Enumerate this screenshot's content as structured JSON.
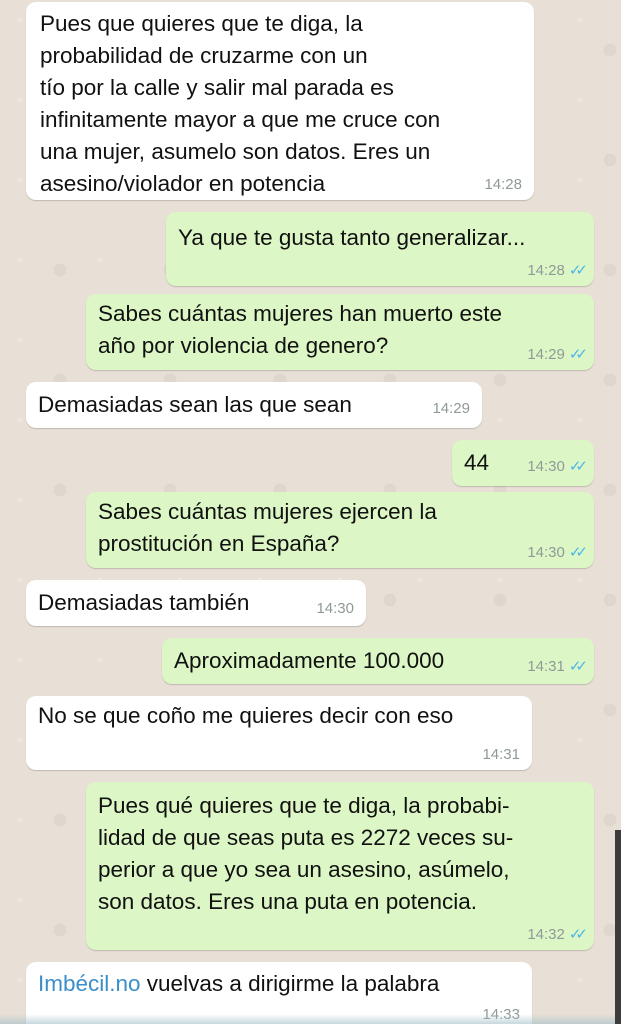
{
  "messages": [
    {
      "dir": "in",
      "lines": [
        "Pues que quieres que te diga, la",
        "probabilidad de cruzarme con un",
        "tío por la calle y salir mal parada es",
        "infinitamente mayor a que me cruce con",
        "una mujer, asumelo son datos. Eres un",
        "asesino/violador en potencia"
      ],
      "time": "14:28"
    },
    {
      "dir": "out",
      "lines": [
        "Ya que te gusta tanto generalizar..."
      ],
      "time": "14:28",
      "ticks": "✓✓"
    },
    {
      "dir": "out",
      "lines": [
        "Sabes cuántas mujeres han muerto este",
        "año por violencia de genero?"
      ],
      "time": "14:29",
      "ticks": "✓✓"
    },
    {
      "dir": "in",
      "lines": [
        "Demasiadas sean las que sean"
      ],
      "time": "14:29"
    },
    {
      "dir": "out",
      "lines": [
        "44"
      ],
      "time": "14:30",
      "ticks": "✓✓"
    },
    {
      "dir": "out",
      "lines": [
        "Sabes cuántas mujeres ejercen la",
        "prostitución en España?"
      ],
      "time": "14:30",
      "ticks": "✓✓"
    },
    {
      "dir": "in",
      "lines": [
        "Demasiadas también"
      ],
      "time": "14:30"
    },
    {
      "dir": "out",
      "lines": [
        "Aproximadamente 100.000"
      ],
      "time": "14:31",
      "ticks": "✓✓"
    },
    {
      "dir": "in",
      "lines": [
        "No se que coño me quieres decir con eso"
      ],
      "time": "14:31"
    },
    {
      "dir": "out",
      "lines": [
        "Pues qué quieres que te diga, la probabi-",
        "lidad de que seas puta es 2272 veces su-",
        "perior a que yo sea un asesino, asúmelo,",
        "son datos. Eres una puta en potencia."
      ],
      "time": "14:32",
      "ticks": "✓✓"
    },
    {
      "dir": "in",
      "link": "Imbécil.no",
      "lines": [
        " vuelvas a dirigirme la palabra"
      ],
      "time": "14:33"
    }
  ],
  "colors": {
    "incoming": "#ffffff",
    "outgoing": "#dcf7c5",
    "read_ticks": "#4fb6ec",
    "time": "#8f9a98",
    "link": "#3b8ec9"
  }
}
